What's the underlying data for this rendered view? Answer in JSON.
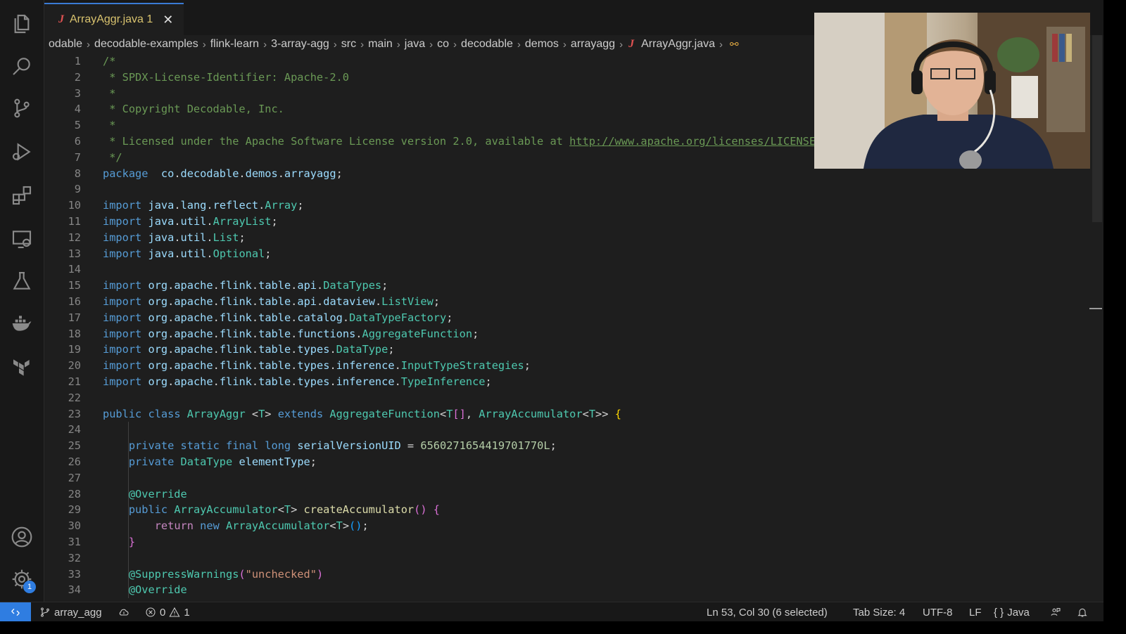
{
  "tab": {
    "filename": "ArrayAggr.java",
    "problems": "1",
    "close_glyph": "✕",
    "file_icon": "J"
  },
  "breadcrumb": [
    "odable",
    "decodable-examples",
    "flink-learn",
    "3-array-agg",
    "src",
    "main",
    "java",
    "co",
    "decodable",
    "demos",
    "arrayagg",
    "ArrayAggr.java"
  ],
  "editor": {
    "lines": [
      [
        [
          "c-cm",
          "/*"
        ]
      ],
      [
        [
          "c-cm",
          " * SPDX-License-Identifier: Apache-2.0"
        ]
      ],
      [
        [
          "c-cm",
          " *"
        ]
      ],
      [
        [
          "c-cm",
          " * Copyright Decodable, Inc."
        ]
      ],
      [
        [
          "c-cm",
          " *"
        ]
      ],
      [
        [
          "c-cm",
          " * Licensed under the Apache Software License version 2.0, available at "
        ],
        [
          "c-url",
          "http://www.apache.org/licenses/LICENSE-"
        ]
      ],
      [
        [
          "c-cm",
          " */"
        ]
      ],
      [
        [
          "c-kw",
          "package"
        ],
        [
          "",
          "  "
        ],
        [
          "c-id",
          "co"
        ],
        [
          "",
          "."
        ],
        [
          "c-id",
          "decodable"
        ],
        [
          "",
          "."
        ],
        [
          "c-id",
          "demos"
        ],
        [
          "",
          "."
        ],
        [
          "c-id",
          "arrayagg"
        ],
        [
          "",
          ";"
        ]
      ],
      [],
      [
        [
          "c-kw",
          "import"
        ],
        [
          "",
          " "
        ],
        [
          "c-id",
          "java"
        ],
        [
          "",
          "."
        ],
        [
          "c-id",
          "lang"
        ],
        [
          "",
          "."
        ],
        [
          "c-id",
          "reflect"
        ],
        [
          "",
          "."
        ],
        [
          "c-ty",
          "Array"
        ],
        [
          "",
          ";"
        ]
      ],
      [
        [
          "c-kw",
          "import"
        ],
        [
          "",
          " "
        ],
        [
          "c-id",
          "java"
        ],
        [
          "",
          "."
        ],
        [
          "c-id",
          "util"
        ],
        [
          "",
          "."
        ],
        [
          "c-ty",
          "ArrayList"
        ],
        [
          "",
          ";"
        ]
      ],
      [
        [
          "c-kw",
          "import"
        ],
        [
          "",
          " "
        ],
        [
          "c-id",
          "java"
        ],
        [
          "",
          "."
        ],
        [
          "c-id",
          "util"
        ],
        [
          "",
          "."
        ],
        [
          "c-ty",
          "List"
        ],
        [
          "",
          ";"
        ]
      ],
      [
        [
          "c-kw",
          "import"
        ],
        [
          "",
          " "
        ],
        [
          "c-id",
          "java"
        ],
        [
          "",
          "."
        ],
        [
          "c-id",
          "util"
        ],
        [
          "",
          "."
        ],
        [
          "c-ty",
          "Optional"
        ],
        [
          "",
          ";"
        ]
      ],
      [],
      [
        [
          "c-kw",
          "import"
        ],
        [
          "",
          " "
        ],
        [
          "c-id",
          "org"
        ],
        [
          "",
          "."
        ],
        [
          "c-id",
          "apache"
        ],
        [
          "",
          "."
        ],
        [
          "c-id",
          "flink"
        ],
        [
          "",
          "."
        ],
        [
          "c-id",
          "table"
        ],
        [
          "",
          "."
        ],
        [
          "c-id",
          "api"
        ],
        [
          "",
          "."
        ],
        [
          "c-ty",
          "DataTypes"
        ],
        [
          "",
          ";"
        ]
      ],
      [
        [
          "c-kw",
          "import"
        ],
        [
          "",
          " "
        ],
        [
          "c-id",
          "org"
        ],
        [
          "",
          "."
        ],
        [
          "c-id",
          "apache"
        ],
        [
          "",
          "."
        ],
        [
          "c-id",
          "flink"
        ],
        [
          "",
          "."
        ],
        [
          "c-id",
          "table"
        ],
        [
          "",
          "."
        ],
        [
          "c-id",
          "api"
        ],
        [
          "",
          "."
        ],
        [
          "c-id",
          "dataview"
        ],
        [
          "",
          "."
        ],
        [
          "c-ty",
          "ListView"
        ],
        [
          "",
          ";"
        ]
      ],
      [
        [
          "c-kw",
          "import"
        ],
        [
          "",
          " "
        ],
        [
          "c-id",
          "org"
        ],
        [
          "",
          "."
        ],
        [
          "c-id",
          "apache"
        ],
        [
          "",
          "."
        ],
        [
          "c-id",
          "flink"
        ],
        [
          "",
          "."
        ],
        [
          "c-id",
          "table"
        ],
        [
          "",
          "."
        ],
        [
          "c-id",
          "catalog"
        ],
        [
          "",
          "."
        ],
        [
          "c-ty",
          "DataTypeFactory"
        ],
        [
          "",
          ";"
        ]
      ],
      [
        [
          "c-kw",
          "import"
        ],
        [
          "",
          " "
        ],
        [
          "c-id",
          "org"
        ],
        [
          "",
          "."
        ],
        [
          "c-id",
          "apache"
        ],
        [
          "",
          "."
        ],
        [
          "c-id",
          "flink"
        ],
        [
          "",
          "."
        ],
        [
          "c-id",
          "table"
        ],
        [
          "",
          "."
        ],
        [
          "c-id",
          "functions"
        ],
        [
          "",
          "."
        ],
        [
          "c-ty",
          "AggregateFunction"
        ],
        [
          "",
          ";"
        ]
      ],
      [
        [
          "c-kw",
          "import"
        ],
        [
          "",
          " "
        ],
        [
          "c-id",
          "org"
        ],
        [
          "",
          "."
        ],
        [
          "c-id",
          "apache"
        ],
        [
          "",
          "."
        ],
        [
          "c-id",
          "flink"
        ],
        [
          "",
          "."
        ],
        [
          "c-id",
          "table"
        ],
        [
          "",
          "."
        ],
        [
          "c-id",
          "types"
        ],
        [
          "",
          "."
        ],
        [
          "c-ty",
          "DataType"
        ],
        [
          "",
          ";"
        ]
      ],
      [
        [
          "c-kw",
          "import"
        ],
        [
          "",
          " "
        ],
        [
          "c-id",
          "org"
        ],
        [
          "",
          "."
        ],
        [
          "c-id",
          "apache"
        ],
        [
          "",
          "."
        ],
        [
          "c-id",
          "flink"
        ],
        [
          "",
          "."
        ],
        [
          "c-id",
          "table"
        ],
        [
          "",
          "."
        ],
        [
          "c-id",
          "types"
        ],
        [
          "",
          "."
        ],
        [
          "c-id",
          "inference"
        ],
        [
          "",
          "."
        ],
        [
          "c-ty",
          "InputTypeStrategies"
        ],
        [
          "",
          ";"
        ]
      ],
      [
        [
          "c-kw",
          "import"
        ],
        [
          "",
          " "
        ],
        [
          "c-id",
          "org"
        ],
        [
          "",
          "."
        ],
        [
          "c-id",
          "apache"
        ],
        [
          "",
          "."
        ],
        [
          "c-id",
          "flink"
        ],
        [
          "",
          "."
        ],
        [
          "c-id",
          "table"
        ],
        [
          "",
          "."
        ],
        [
          "c-id",
          "types"
        ],
        [
          "",
          "."
        ],
        [
          "c-id",
          "inference"
        ],
        [
          "",
          "."
        ],
        [
          "c-ty",
          "TypeInference"
        ],
        [
          "",
          ";"
        ]
      ],
      [],
      [
        [
          "c-kw",
          "public"
        ],
        [
          "",
          " "
        ],
        [
          "c-kw",
          "class"
        ],
        [
          "",
          " "
        ],
        [
          "c-ty",
          "ArrayAggr"
        ],
        [
          "",
          " <"
        ],
        [
          "c-ty",
          "T"
        ],
        [
          "",
          "> "
        ],
        [
          "c-kw",
          "extends"
        ],
        [
          "",
          " "
        ],
        [
          "c-ty",
          "AggregateFunction"
        ],
        [
          "",
          "<"
        ],
        [
          "c-ty",
          "T"
        ],
        [
          "c-br2",
          "[]"
        ],
        [
          ", "
        ],
        [
          "c-ty",
          "ArrayAccumulator"
        ],
        [
          "",
          "<"
        ],
        [
          "c-ty",
          "T"
        ],
        [
          "",
          ">> "
        ],
        [
          "c-br",
          "{"
        ]
      ],
      [],
      [
        [
          "",
          "    "
        ],
        [
          "c-kw",
          "private"
        ],
        [
          "",
          " "
        ],
        [
          "c-kw",
          "static"
        ],
        [
          "",
          " "
        ],
        [
          "c-kw",
          "final"
        ],
        [
          "",
          " "
        ],
        [
          "c-kw",
          "long"
        ],
        [
          "",
          " "
        ],
        [
          "c-id",
          "serialVersionUID"
        ],
        [
          "",
          " = "
        ],
        [
          "c-num",
          "6560271654419701770L"
        ],
        [
          "",
          ";"
        ]
      ],
      [
        [
          "",
          "    "
        ],
        [
          "c-kw",
          "private"
        ],
        [
          "",
          " "
        ],
        [
          "c-ty",
          "DataType"
        ],
        [
          "",
          " "
        ],
        [
          "c-id",
          "elementType"
        ],
        [
          "",
          ";"
        ]
      ],
      [],
      [
        [
          "",
          "    "
        ],
        [
          "c-ty",
          "@Override"
        ]
      ],
      [
        [
          "",
          "    "
        ],
        [
          "c-kw",
          "public"
        ],
        [
          "",
          " "
        ],
        [
          "c-ty",
          "ArrayAccumulator"
        ],
        [
          "",
          "<"
        ],
        [
          "c-ty",
          "T"
        ],
        [
          "",
          "> "
        ],
        [
          "c-fn",
          "createAccumulator"
        ],
        [
          "c-br2",
          "()"
        ],
        [
          "",
          " "
        ],
        [
          "c-br2",
          "{"
        ]
      ],
      [
        [
          "",
          "        "
        ],
        [
          "c-kw2",
          "return"
        ],
        [
          "",
          " "
        ],
        [
          "c-kw",
          "new"
        ],
        [
          "",
          " "
        ],
        [
          "c-ty",
          "ArrayAccumulator"
        ],
        [
          "",
          "<"
        ],
        [
          "c-ty",
          "T"
        ],
        [
          "",
          ">"
        ],
        [
          "c-br3",
          "()"
        ],
        [
          "",
          ";"
        ]
      ],
      [
        [
          "",
          "    "
        ],
        [
          "c-br2",
          "}"
        ]
      ],
      [],
      [
        [
          "",
          "    "
        ],
        [
          "c-ty",
          "@SuppressWarnings"
        ],
        [
          "c-br2",
          "("
        ],
        [
          "c-str",
          "\"unchecked\""
        ],
        [
          "c-br2",
          ")"
        ]
      ],
      [
        [
          "",
          "    "
        ],
        [
          "c-ty",
          "@Override"
        ]
      ]
    ]
  },
  "statusbar": {
    "branch": "array_agg",
    "errors": "0",
    "warnings": "1",
    "cursor": "Ln 53, Col 30 (6 selected)",
    "tab_size": "Tab Size: 4",
    "encoding": "UTF-8",
    "eol": "LF",
    "language": "Java"
  },
  "icons": {
    "activity": [
      "files-icon",
      "search-icon",
      "source-control-icon",
      "run-debug-icon",
      "extensions-icon",
      "remote-explorer-icon",
      "testing-icon",
      "docker-icon",
      "terraform-icon",
      "account-icon",
      "settings-gear-icon"
    ],
    "settings_badge": "1"
  },
  "colors": {
    "accent": "#2f7de1",
    "tab_border": "#3a7bd5",
    "modified": "#d8c26e",
    "java_icon": "#e05252"
  }
}
